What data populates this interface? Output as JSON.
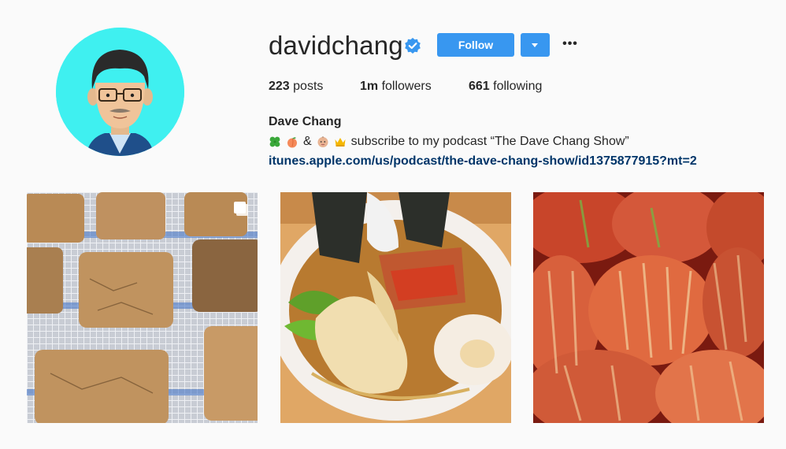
{
  "profile": {
    "username": "davidchang",
    "verified": true,
    "follow_label": "Follow",
    "more_label": "•••",
    "stats": {
      "posts_count": "223",
      "posts_label": " posts",
      "followers_count": "1m",
      "followers_label": " followers",
      "following_count": "661",
      "following_label": " following"
    },
    "full_name": "Dave Chang",
    "bio": {
      "emojis": [
        "four-leaf-clover",
        "peach",
        "baby-face",
        "crown"
      ],
      "amp": "&",
      "text": "subscribe to my podcast “The Dave Chang Show”"
    },
    "link": "itunes.apple.com/us/podcast/the-dave-chang-show/id1375877915?mt=2"
  },
  "posts": [
    {
      "subject": "crackers-on-drying-rack",
      "multi": true
    },
    {
      "subject": "ramen-bowl",
      "multi": false
    },
    {
      "subject": "kimchi",
      "multi": false
    }
  ],
  "colors": {
    "accent": "#3897f0",
    "link": "#003569",
    "avatar_bg": "#3ff0f0",
    "verified": "#3897f0"
  }
}
